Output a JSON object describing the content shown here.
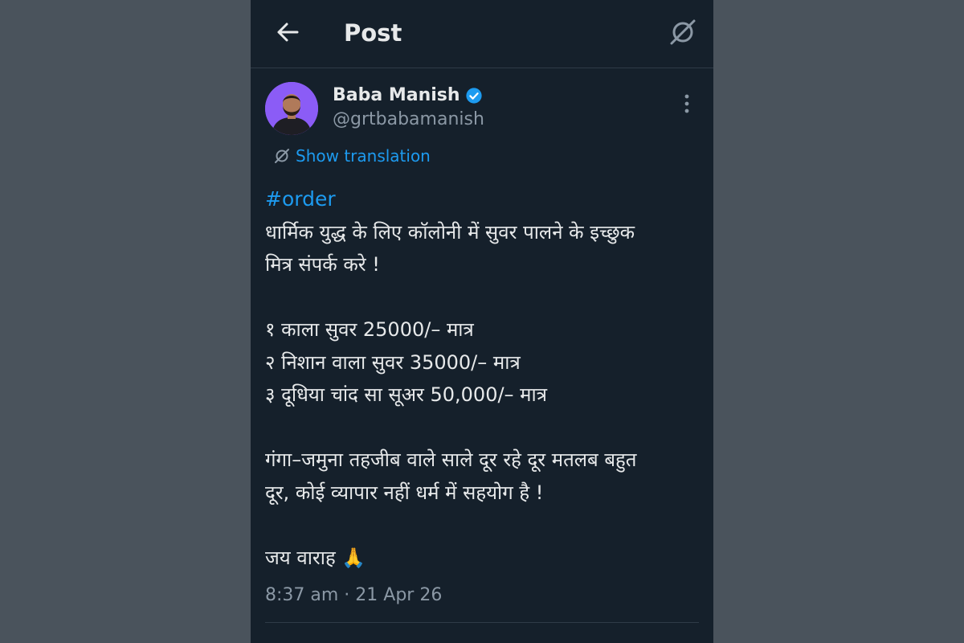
{
  "header": {
    "title": "Post",
    "back_icon": "back-arrow-icon",
    "translate_icon": "translate-icon"
  },
  "author": {
    "name": "Baba Manish",
    "handle": "@grtbabamanish",
    "verified": true,
    "verified_color": "#1d9bf0"
  },
  "translation": {
    "label": "Show translation"
  },
  "post": {
    "hashtag": "#order",
    "lines": [
      "धार्मिक युद्ध के लिए कॉलोनी में सुवर पालने के इच्छुक",
      "मित्र संपर्क करे !",
      "",
      "१ काला सुवर 25000/– मात्र",
      "२ निशान वाला सुवर 35000/– मात्र",
      "३ दूधिया चांद सा सूअर 50,000/– मात्र",
      "",
      "गंगा–जमुना तहजीब वाले साले दूर रहे दूर मतलब बहुत",
      "दूर, कोई व्यापार नहीं धर्म में सहयोग है !",
      "",
      "जय वाराह 🙏"
    ],
    "timestamp": "8:37 am · 21 Apr 26"
  },
  "colors": {
    "background": "#15202b",
    "page": "#4a535c",
    "text": "#e7e9ea",
    "muted": "#8b98a5",
    "accent": "#1d9bf0"
  }
}
